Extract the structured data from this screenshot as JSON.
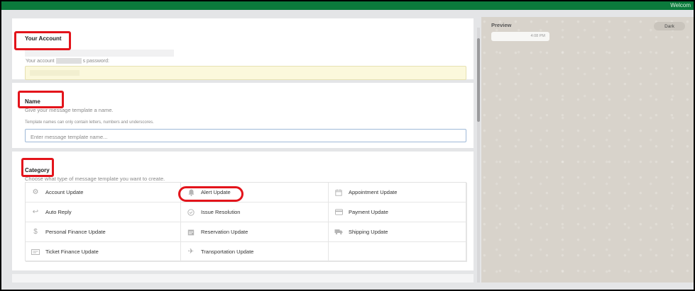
{
  "header": {
    "welcome": "Welcom"
  },
  "account": {
    "heading": "Your Account",
    "pw_label_prefix": "Your account",
    "pw_label_suffix": "s password:"
  },
  "name": {
    "heading": "Name",
    "description": "Give your message template a name.",
    "hint": "Template names can only contain letters, numbers and underscores.",
    "placeholder": "Enter message template name..."
  },
  "category": {
    "heading": "Category",
    "description": "Choose what type of message template you want to create.",
    "items": [
      {
        "label": "Account Update",
        "icon": "gear-icon"
      },
      {
        "label": "Alert Update",
        "icon": "bell-icon"
      },
      {
        "label": "Appointment Update",
        "icon": "calendar-icon"
      },
      {
        "label": "Auto Reply",
        "icon": "reply-icon"
      },
      {
        "label": "Issue Resolution",
        "icon": "check-circle-icon"
      },
      {
        "label": "Payment Update",
        "icon": "credit-card-icon"
      },
      {
        "label": "Personal Finance Update",
        "icon": "dollar-icon"
      },
      {
        "label": "Reservation Update",
        "icon": "calendar-grid-icon"
      },
      {
        "label": "Shipping Update",
        "icon": "truck-icon"
      },
      {
        "label": "Ticket Finance Update",
        "icon": "ticket-icon"
      },
      {
        "label": "Transportation Update",
        "icon": "plane-icon"
      }
    ]
  },
  "preview": {
    "title": "Preview",
    "dark_label": "Dark",
    "time": "4:08 PM"
  },
  "colors": {
    "topbar": "#0b7a3c",
    "highlight": "#e3141b",
    "input_border": "#9fb9d8"
  }
}
